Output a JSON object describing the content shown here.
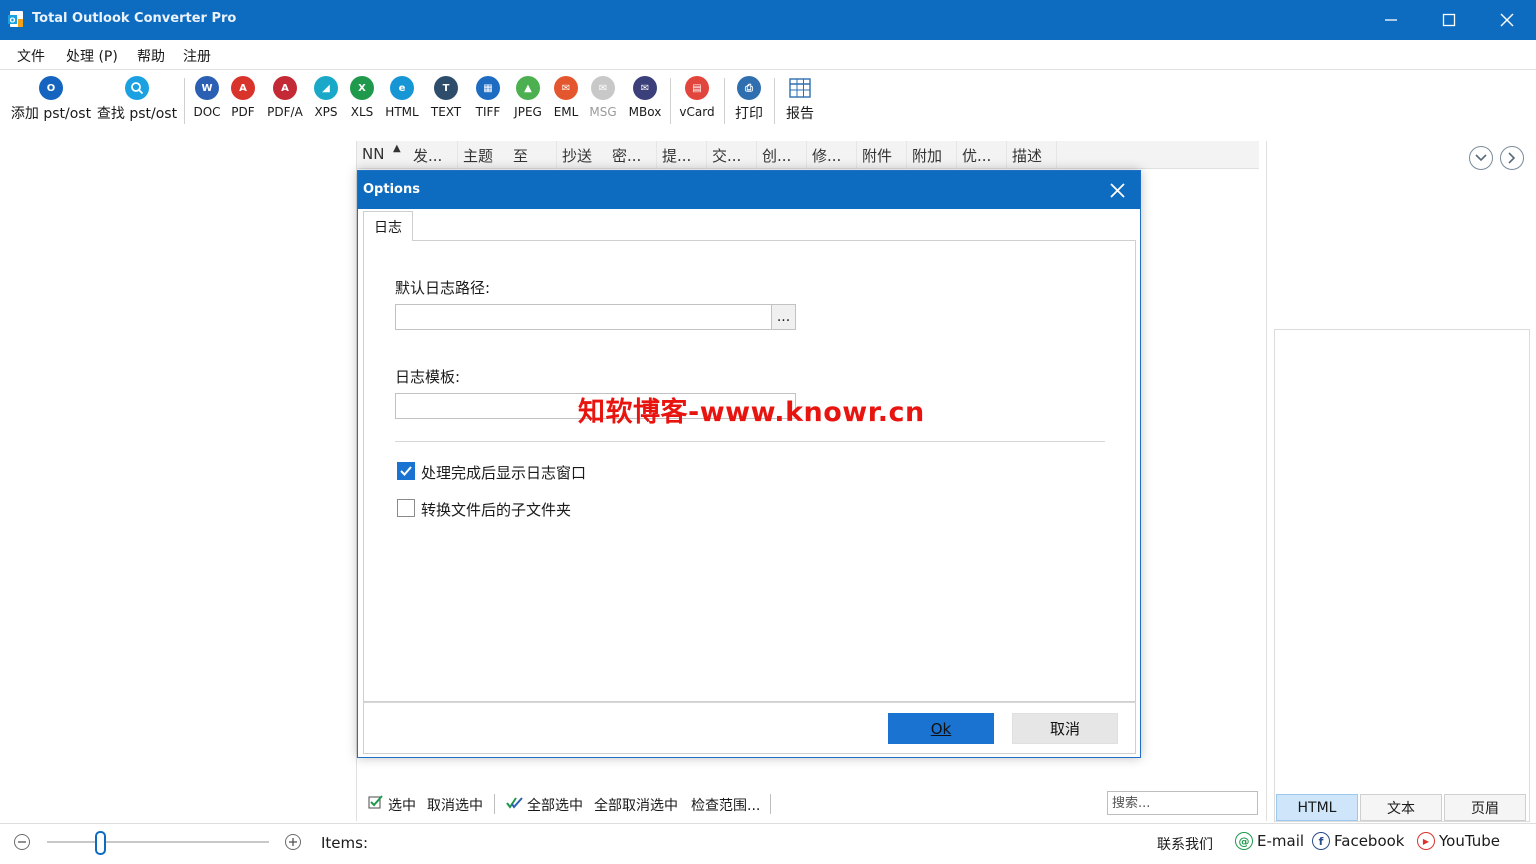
{
  "window": {
    "title": "Total Outlook Converter Pro"
  },
  "menu": [
    "文件",
    "处理 (P)",
    "帮助",
    "注册"
  ],
  "toolbar": {
    "add": "添加 pst/ost",
    "find": "查找 pst/ost",
    "formats": [
      "DOC",
      "PDF",
      "PDF/A",
      "XPS",
      "XLS",
      "HTML",
      "TEXT",
      "TIFF",
      "JPEG",
      "EML",
      "MSG",
      "MBox"
    ],
    "vcard": "vCard",
    "print": "打印",
    "report": "报告"
  },
  "grid": {
    "columns": [
      "NN",
      "发...",
      "主题",
      "至",
      "抄送",
      "密...",
      "提...",
      "交...",
      "创...",
      "修...",
      "附件",
      "附加",
      "优...",
      "描述"
    ]
  },
  "dialog": {
    "title": "Options",
    "tab": "日志",
    "log_path_label": "默认日志路径:",
    "log_path_value": "",
    "browse_label": "...",
    "template_label": "日志模板:",
    "template_value": "",
    "checkbox_show_log": "处理完成后显示日志窗口",
    "checkbox_show_log_checked": true,
    "checkbox_subfolder": "转换文件后的子文件夹",
    "checkbox_subfolder_checked": false,
    "ok": "Ok",
    "cancel": "取消"
  },
  "watermark": "知软博客-www.knowr.cn",
  "selection_bar": {
    "select": "选中",
    "deselect": "取消选中",
    "select_all": "全部选中",
    "deselect_all": "全部取消选中",
    "check_range": "检查范围...",
    "search_placeholder": "搜索..."
  },
  "preview_tabs": [
    "HTML",
    "文本",
    "页眉"
  ],
  "status": {
    "items_label": "Items:",
    "contact": "联系我们",
    "email": "E-mail",
    "facebook": "Facebook",
    "youtube": "YouTube"
  },
  "colors": {
    "accent": "#0e6cc0",
    "ok_button": "#1a73d1",
    "watermark": "#e8140f"
  }
}
